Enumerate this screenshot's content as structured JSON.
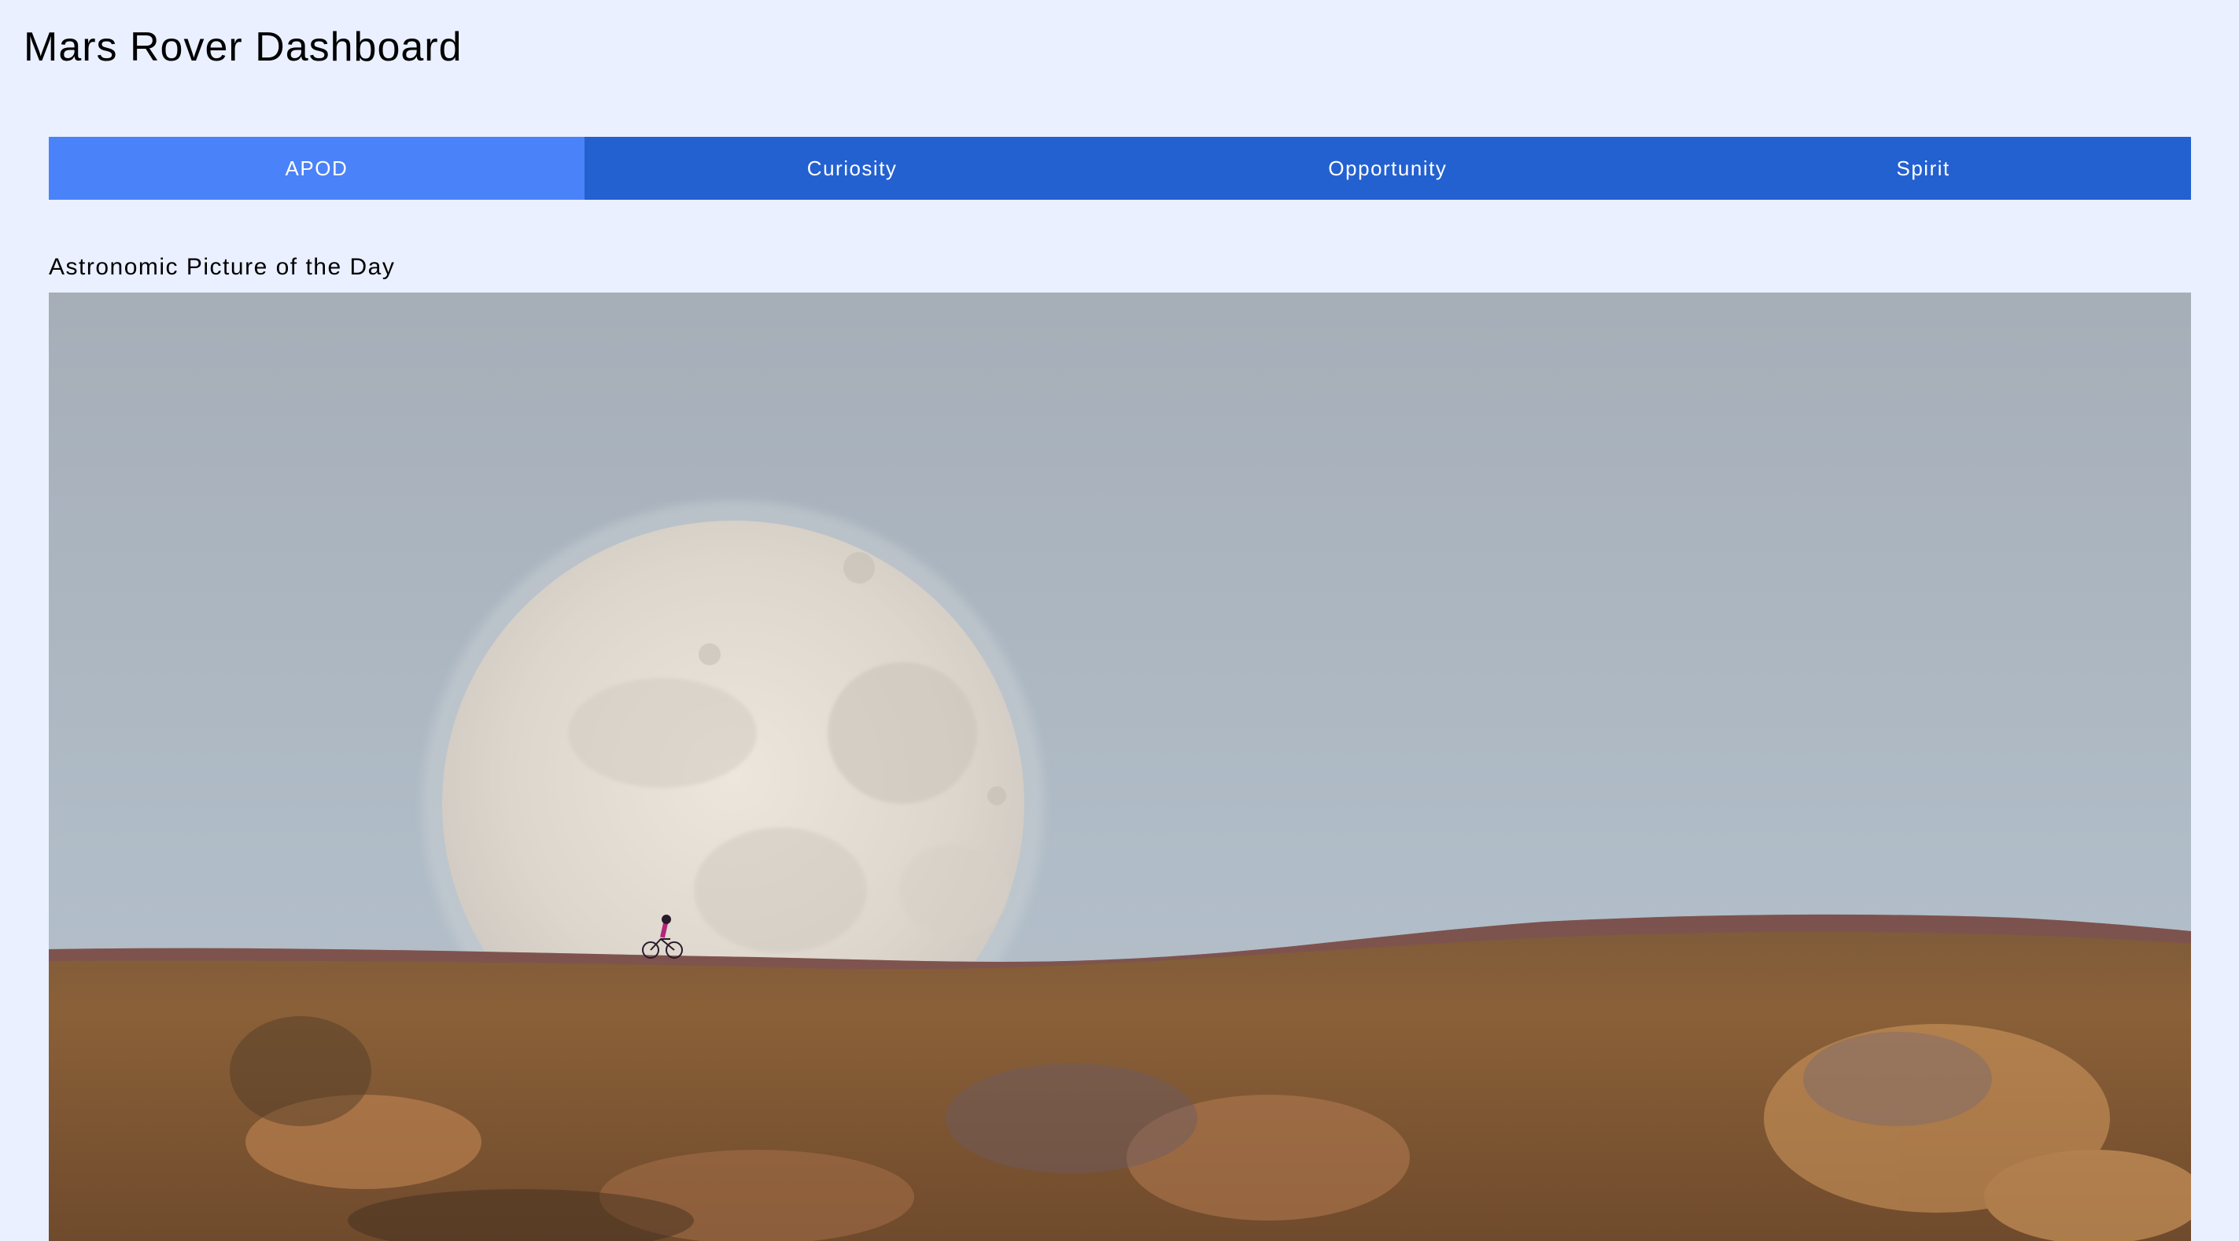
{
  "app": {
    "title": "Mars Rover Dashboard"
  },
  "tabs": [
    {
      "label": "APOD",
      "active": true
    },
    {
      "label": "Curiosity",
      "active": false
    },
    {
      "label": "Opportunity",
      "active": false
    },
    {
      "label": "Spirit",
      "active": false
    }
  ],
  "apod": {
    "heading": "Astronomic Picture of the Day",
    "image_subject": "moon-over-hillside-with-cyclist"
  },
  "colors": {
    "background": "#eaf0ff",
    "tab_bar": "#2361d1",
    "tab_active": "#4a82f9",
    "tab_text": "#ffffff"
  }
}
